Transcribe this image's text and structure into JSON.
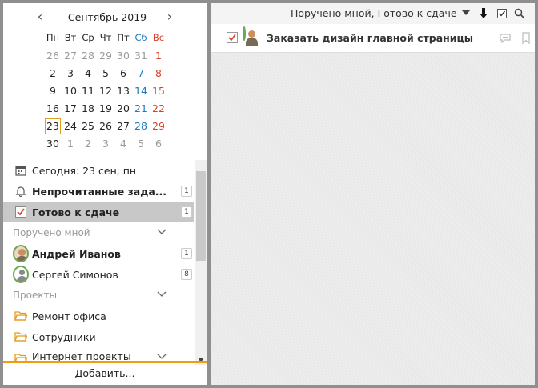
{
  "calendar": {
    "month_title": "Сентябрь 2019",
    "weekdays": [
      "Пн",
      "Вт",
      "Ср",
      "Чт",
      "Пт",
      "Сб",
      "Вс"
    ],
    "weeks": [
      [
        "26",
        "27",
        "28",
        "29",
        "30",
        "31",
        "1"
      ],
      [
        "2",
        "3",
        "4",
        "5",
        "6",
        "7",
        "8"
      ],
      [
        "9",
        "10",
        "11",
        "12",
        "13",
        "14",
        "15"
      ],
      [
        "16",
        "17",
        "18",
        "19",
        "20",
        "21",
        "22"
      ],
      [
        "23",
        "24",
        "25",
        "26",
        "27",
        "28",
        "29"
      ],
      [
        "30",
        "1",
        "2",
        "3",
        "4",
        "5",
        "6"
      ]
    ],
    "today": "23"
  },
  "sidebar": {
    "today_label": "Сегодня: 23 сен, пн",
    "unread_label": "Непрочитанные зада...",
    "unread_count": "1",
    "ready_label": "Готово к сдаче",
    "ready_count": "1",
    "assigned_section": "Поручено мной",
    "people": [
      {
        "name": "Андрей Иванов",
        "count": "1"
      },
      {
        "name": "Сергей Симонов",
        "count": "8"
      }
    ],
    "projects_section": "Проекты",
    "projects": [
      "Ремонт офиса",
      "Сотрудники",
      "Интернет проекты"
    ],
    "add_label": "Добавить..."
  },
  "main": {
    "filter_label": "Поручено мной, Готово к сдаче",
    "tasks": [
      {
        "title": "Заказать дизайн главной страницы"
      }
    ]
  },
  "colors": {
    "accent": "#f39c12",
    "weekend_sat": "#1f7bc1",
    "weekend_sun": "#d9412b",
    "avatar_ring": "#6aa84f",
    "check": "#d9412b"
  }
}
